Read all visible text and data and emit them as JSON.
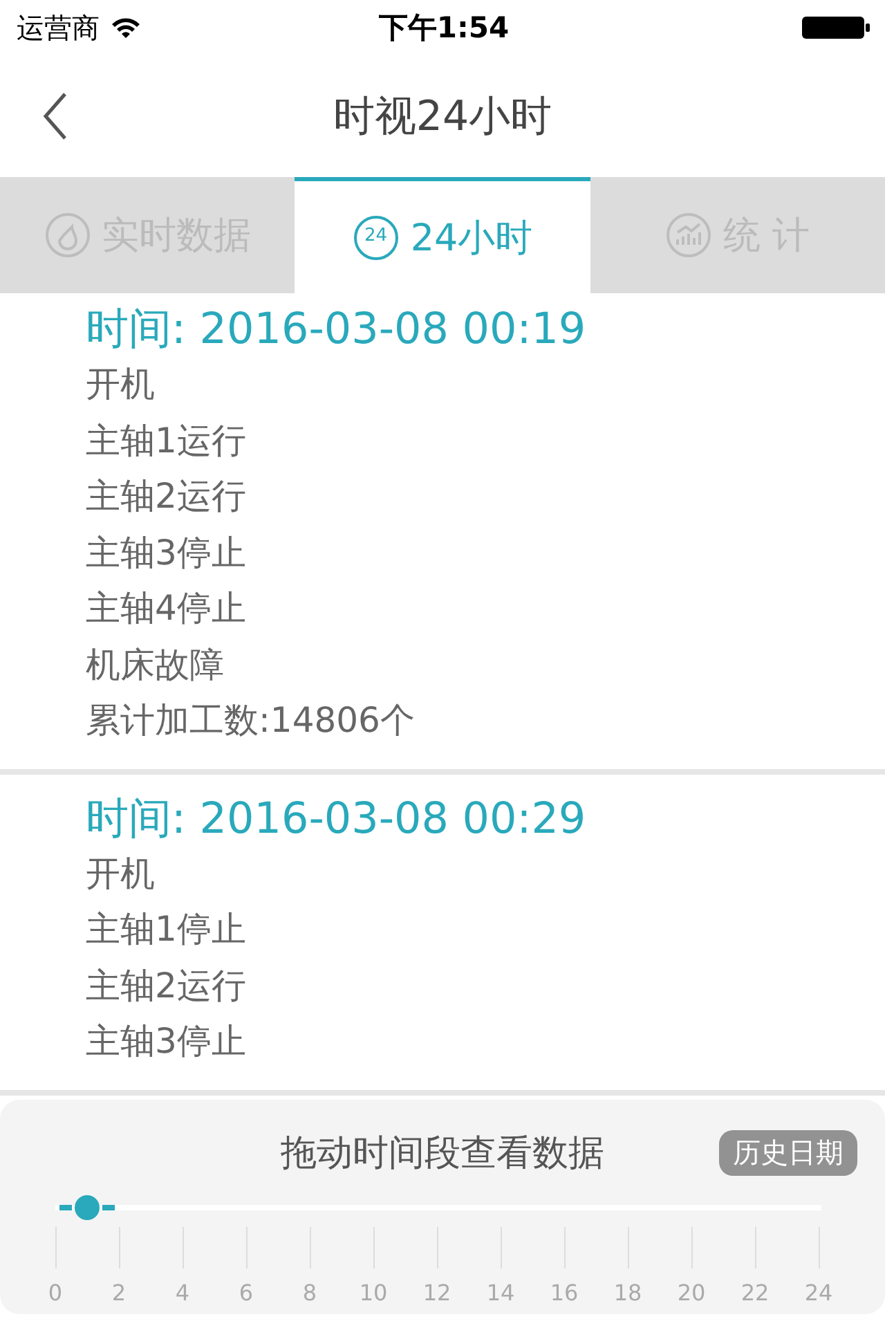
{
  "status_bar": {
    "carrier": "运营商",
    "time": "下午1:54"
  },
  "nav": {
    "title": "时视24小时"
  },
  "tabs": [
    {
      "label": "实时数据",
      "kind": "gauge",
      "selected": false
    },
    {
      "label": "24小时",
      "kind": "hours",
      "badge": "24",
      "selected": true
    },
    {
      "label": "统 计",
      "kind": "stats",
      "selected": false
    }
  ],
  "records": [
    {
      "time": "时间: 2016-03-08 00:19",
      "lines": [
        "开机",
        "主轴1运行",
        "主轴2运行",
        "主轴3停止",
        "主轴4停止",
        "机床故障",
        "累计加工数:14806个"
      ]
    },
    {
      "time": "时间: 2016-03-08 00:29",
      "lines": [
        "开机",
        "主轴1停止",
        "主轴2运行",
        "主轴3停止"
      ]
    }
  ],
  "panel": {
    "title": "拖动时间段查看数据",
    "history_button": "历史日期",
    "slider": {
      "level": 0.042
    },
    "ticks": [
      "0",
      "2",
      "4",
      "6",
      "8",
      "10",
      "12",
      "14",
      "16",
      "18",
      "20",
      "22",
      "24"
    ]
  }
}
